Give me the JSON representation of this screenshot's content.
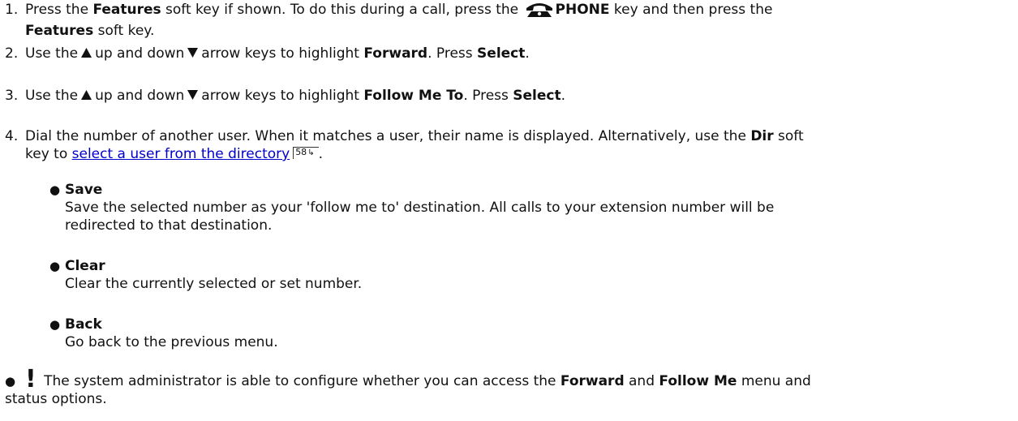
{
  "steps": [
    {
      "num": "1.",
      "t1": "Press the ",
      "b1": "Features",
      "t2": " soft key if shown. To do this during a call, press the ",
      "b2": "PHONE",
      "t3": " key and then press the",
      "b3": "Features",
      "t4": " soft key."
    },
    {
      "num": "2.",
      "t1": "Use the",
      "t2": "up and down",
      "t3": "arrow keys to highlight ",
      "b1": "Forward",
      "t4": ". Press ",
      "b2": "Select",
      "t5": "."
    },
    {
      "num": "3.",
      "t1": "Use the",
      "t2": "up and down",
      "t3": "arrow keys to highlight ",
      "b1": "Follow Me To",
      "t4": ". Press ",
      "b2": "Select",
      "t5": "."
    },
    {
      "num": "4.",
      "t1": "Dial the number of another user. When it matches a user, their name is displayed. Alternatively, use the ",
      "b1": "Dir",
      "t2": " soft",
      "t3": "key to ",
      "link": "select a user from the directory",
      "ref": "58",
      "t4": "."
    }
  ],
  "options": [
    {
      "title": "Save",
      "desc1": "Save the selected number as your 'follow me to' destination. All calls to your extension number will be",
      "desc2": "redirected to that destination."
    },
    {
      "title": "Clear",
      "desc1": "Clear the currently selected or set number."
    },
    {
      "title": "Back",
      "desc1": "Go back to the previous menu."
    }
  ],
  "note": {
    "bang": "!",
    "t1": " The system administrator is able to configure whether you can access the ",
    "b1": "Forward",
    "t2": " and ",
    "b2": "Follow Me",
    "t3": " menu and",
    "t4": "status options."
  },
  "colors": {
    "text": "#111111",
    "link": "#0000cc"
  },
  "icons": {
    "phone": "phone-key-icon",
    "up": "up-arrow-icon",
    "down": "down-arrow-icon",
    "note": "exclamation-icon"
  }
}
